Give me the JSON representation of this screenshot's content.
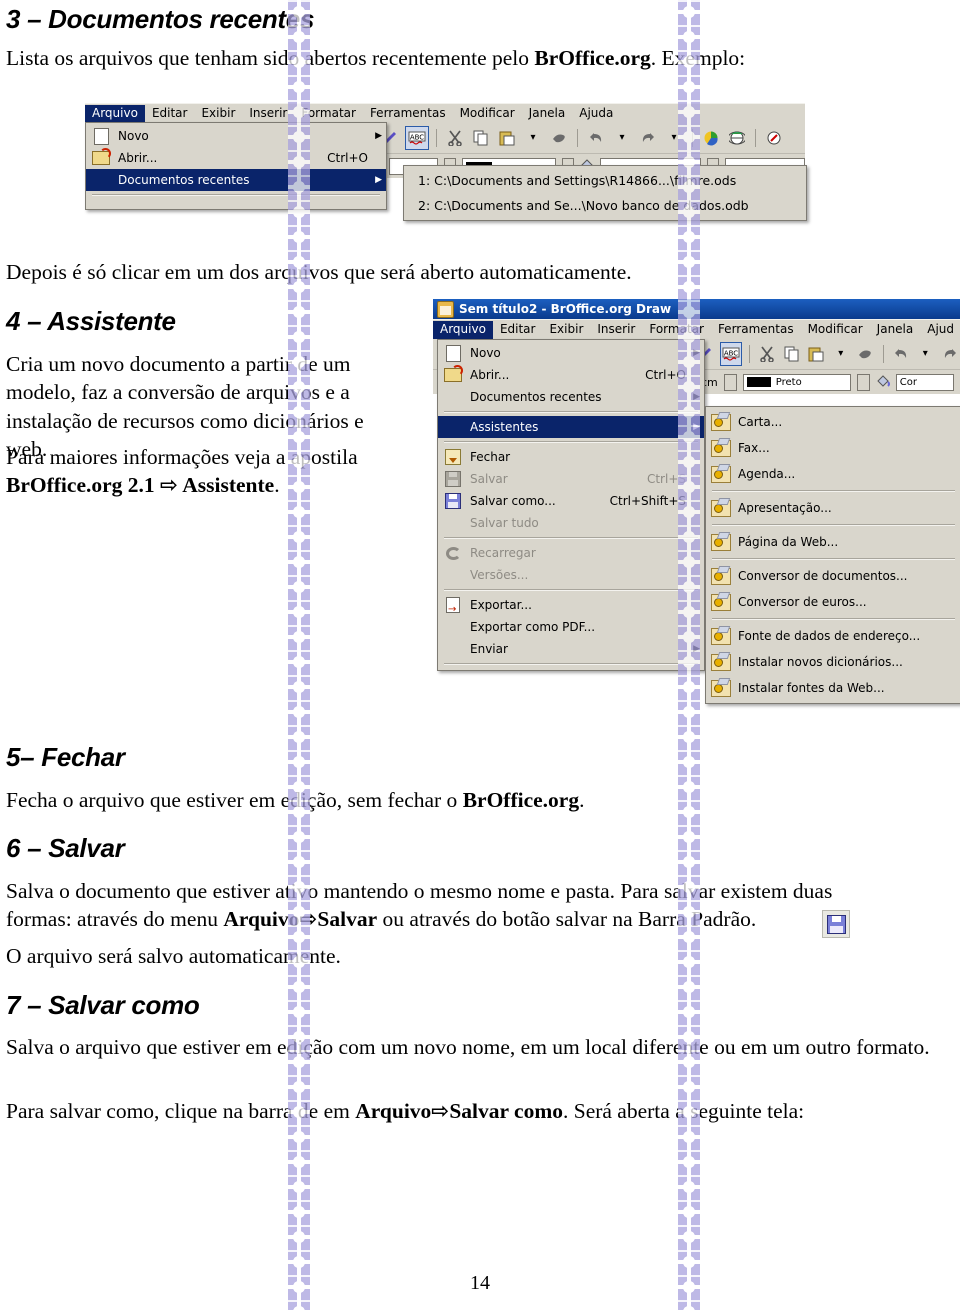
{
  "document": {
    "page_number": "14",
    "sections": [
      {
        "id": "s3",
        "heading": "3 – Documentos recentes",
        "intro_a": "Lista os arquivos que tenham sido abertos recentemente pelo ",
        "intro_b": "BrOffice.org",
        "intro_c": ". Exemplo:",
        "after": "Depois é só clicar em um dos arquivos que será aberto automaticamente."
      },
      {
        "id": "s4",
        "heading": "4 – Assistente",
        "para_a": "Cria um novo documento a partir de um modelo, faz a conversão de arquivos e a instalação de recursos como dicionários e web.",
        "para_b_1": "Para maiores informações veja a apostila ",
        "para_b_2": "BrOffice.org 2.1 ",
        "para_b_arrow": "⇨",
        "para_b_3": " Assistente",
        "para_b_4": "."
      },
      {
        "id": "s5",
        "heading": "5– Fechar",
        "para_1": "Fecha o arquivo que estiver em edição, sem fechar o ",
        "para_2": "BrOffice.org",
        "para_3": "."
      },
      {
        "id": "s6",
        "heading": "6 – Salvar",
        "para_1": "Salva o documento que estiver ativo mantendo o mesmo nome e pasta. Para salvar existem duas formas: através do menu ",
        "para_2": "Arquivo",
        "para_arrow": "⇨",
        "para_3": "Salvar",
        "para_4": " ou através do botão salvar na Barra Padrão.",
        "para_after": "O arquivo será salvo automaticamente.",
        "save_icon_name": "floppy-disk-save-icon"
      },
      {
        "id": "s7",
        "heading": "7 – Salvar como",
        "para_1": "Salva o arquivo que estiver em edição com um novo nome, em um local diferente ou em um outro formato.",
        "para_2_a": "Para salvar como, clique na barra de em ",
        "para_2_b": "Arquivo",
        "para_2_arrow": "⇨",
        "para_2_c": "Salvar como",
        "para_2_d": ". Será aberta a seguinte tela:"
      }
    ]
  },
  "screenshot_1": {
    "name": "broffice-arquivo-documentos-recentes",
    "menubar": [
      {
        "label": "Arquivo",
        "selected": true
      },
      {
        "label": "Editar",
        "selected": false
      },
      {
        "label": "Exibir",
        "selected": false
      },
      {
        "label": "Inserir",
        "selected": false
      },
      {
        "label": "Formatar",
        "selected": false
      },
      {
        "label": "Ferramentas",
        "selected": false
      },
      {
        "label": "Modificar",
        "selected": false
      },
      {
        "label": "Janela",
        "selected": false
      },
      {
        "label": "Ajuda",
        "selected": false
      }
    ],
    "file_menu": [
      {
        "label": "Novo",
        "accel": "",
        "submenu": true,
        "icon": "new-document-icon",
        "highlighted": false,
        "disabled": false
      },
      {
        "label": "Abrir...",
        "accel": "Ctrl+O",
        "submenu": false,
        "icon": "open-folder-icon",
        "highlighted": false,
        "disabled": false
      },
      {
        "label": "Documentos recentes",
        "accel": "",
        "submenu": true,
        "icon": "",
        "highlighted": true,
        "disabled": false
      }
    ],
    "recent_documents": [
      {
        "label": "1: C:\\Documents and Settings\\R14866...\\filmre.ods"
      },
      {
        "label": "2: C:\\Documents and Se...\\Novo banco de dados.odb"
      }
    ],
    "toolbar_icons": [
      "pen-icon",
      "spellcheck-abc-icon",
      "cut-scissors-icon",
      "copy-icon",
      "paste-icon",
      "paste-dropdown-icon",
      "clone-formatting-icon",
      "undo-icon",
      "undo-dropdown-icon",
      "redo-icon",
      "redo-dropdown-icon",
      "chart-pie-icon",
      "globe-icon",
      "hyperlink-icon"
    ]
  },
  "screenshot_2": {
    "name": "broffice-draw-arquivo-assistentes",
    "title": "Sem título2 - BrOffice.org Draw",
    "title_icon": "broffice-draw-app-icon",
    "menubar": [
      {
        "label": "Arquivo",
        "selected": true
      },
      {
        "label": "Editar",
        "selected": false
      },
      {
        "label": "Exibir",
        "selected": false
      },
      {
        "label": "Inserir",
        "selected": false
      },
      {
        "label": "Formatar",
        "selected": false
      },
      {
        "label": "Ferramentas",
        "selected": false
      },
      {
        "label": "Modificar",
        "selected": false
      },
      {
        "label": "Janela",
        "selected": false
      },
      {
        "label": "Ajud",
        "selected": false
      }
    ],
    "file_menu": [
      {
        "label": "Novo",
        "accel": "",
        "submenu": true,
        "icon": "new-document-icon",
        "highlighted": false,
        "disabled": false
      },
      {
        "label": "Abrir...",
        "accel": "Ctrl+O",
        "submenu": false,
        "icon": "open-folder-icon",
        "highlighted": false,
        "disabled": false
      },
      {
        "label": "Documentos recentes",
        "accel": "",
        "submenu": true,
        "icon": "",
        "highlighted": false,
        "disabled": false
      },
      {
        "separator": true
      },
      {
        "label": "Assistentes",
        "accel": "",
        "submenu": true,
        "icon": "",
        "highlighted": true,
        "disabled": false
      },
      {
        "separator": true
      },
      {
        "label": "Fechar",
        "accel": "",
        "submenu": false,
        "icon": "close-document-icon",
        "highlighted": false,
        "disabled": false
      },
      {
        "label": "Salvar",
        "accel": "Ctrl+S",
        "submenu": false,
        "icon": "save-icon-disabled",
        "highlighted": false,
        "disabled": true
      },
      {
        "label": "Salvar como...",
        "accel": "Ctrl+Shift+S",
        "submenu": false,
        "icon": "save-as-icon",
        "highlighted": false,
        "disabled": false
      },
      {
        "label": "Salvar tudo",
        "accel": "",
        "submenu": false,
        "icon": "",
        "highlighted": false,
        "disabled": true
      },
      {
        "separator": true
      },
      {
        "label": "Recarregar",
        "accel": "",
        "submenu": false,
        "icon": "reload-icon",
        "highlighted": false,
        "disabled": true
      },
      {
        "label": "Versões...",
        "accel": "",
        "submenu": false,
        "icon": "",
        "highlighted": false,
        "disabled": true
      },
      {
        "separator": true
      },
      {
        "label": "Exportar...",
        "accel": "",
        "submenu": false,
        "icon": "export-icon",
        "highlighted": false,
        "disabled": false
      },
      {
        "label": "Exportar como PDF...",
        "accel": "",
        "submenu": false,
        "icon": "",
        "highlighted": false,
        "disabled": false
      },
      {
        "label": "Enviar",
        "accel": "",
        "submenu": true,
        "icon": "",
        "highlighted": false,
        "disabled": false
      }
    ],
    "assistentes_submenu": [
      {
        "label": "Carta...",
        "icon": "wizard-icon"
      },
      {
        "label": "Fax...",
        "icon": "wizard-icon"
      },
      {
        "label": "Agenda...",
        "icon": "wizard-icon"
      },
      {
        "separator": true
      },
      {
        "label": "Apresentação...",
        "icon": "wizard-icon"
      },
      {
        "separator": true
      },
      {
        "label": "Página da Web...",
        "icon": "wizard-icon"
      },
      {
        "separator": true
      },
      {
        "label": "Conversor de documentos...",
        "icon": "wizard-icon"
      },
      {
        "label": "Conversor de euros...",
        "icon": "wizard-icon"
      },
      {
        "separator": true
      },
      {
        "label": "Fonte de dados de endereço...",
        "icon": "wizard-icon"
      },
      {
        "label": "Instalar novos dicionários...",
        "icon": "wizard-icon"
      },
      {
        "label": "Instalar fontes da Web...",
        "icon": "wizard-icon"
      }
    ],
    "toolbar_icons": [
      "pen-icon",
      "spellcheck-abc-icon",
      "cut-scissors-icon",
      "copy-icon",
      "paste-icon",
      "paste-dropdown-icon",
      "clone-formatting-icon",
      "undo-icon",
      "undo-dropdown-icon",
      "redo-icon"
    ],
    "format_bar": {
      "unit": "cm",
      "line_color": "Preto",
      "fill_label": "Cor"
    }
  },
  "colors": {
    "menu_face": "#d9d6cc",
    "menu_highlight": "#0a246a",
    "titlebar": "#0a3a8c",
    "watermark": "#a9a2de",
    "text": "#000000"
  }
}
